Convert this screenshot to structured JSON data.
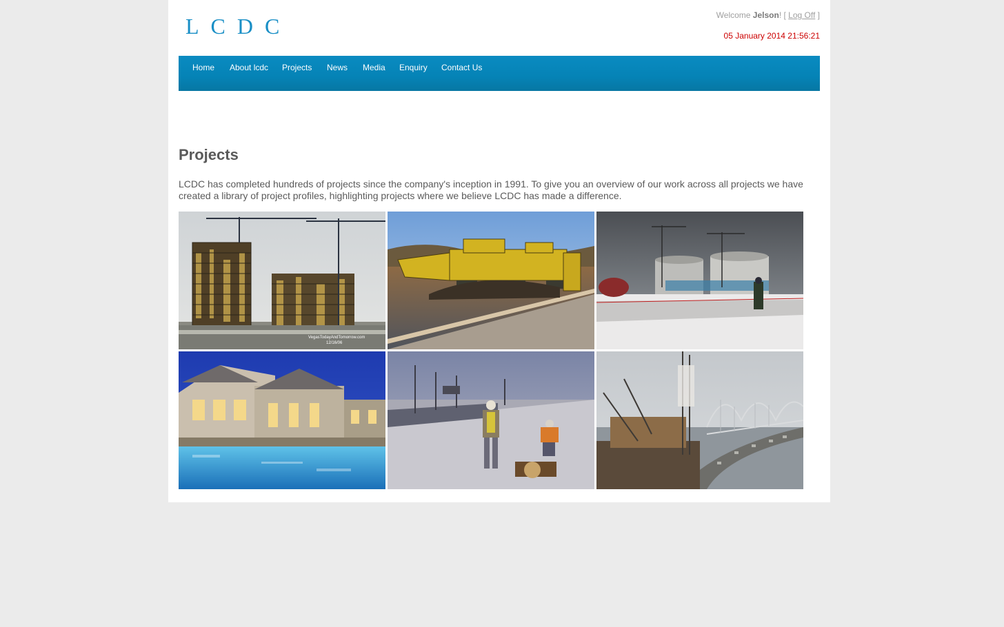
{
  "header": {
    "logo_letters": [
      "L",
      "C",
      "D",
      "C"
    ],
    "welcome_prefix": "Welcome",
    "username": "Jelson",
    "welcome_suffix": "! [",
    "logoff_label": "Log Off",
    "logoff_close": "]",
    "datetime": "05 January 2014 21:56:21"
  },
  "nav": {
    "items": [
      "Home",
      "About lcdc",
      "Projects",
      "News",
      "Media",
      "Enquiry",
      "Contact Us"
    ]
  },
  "main": {
    "title": "Projects",
    "intro": "LCDC has completed hundreds of projects since the company's inception in 1991. To give you an overview of our work across all projects we have created a library of project profiles, highlighting projects where we believe LCDC has made a difference."
  },
  "gallery": {
    "tiles": [
      {
        "icon": "highrise-construction-photo",
        "caption": "VegasTodayAndTomorrow.com 12/16/06"
      },
      {
        "icon": "road-paver-photo"
      },
      {
        "icon": "lng-tank-construction-photo"
      },
      {
        "icon": "pool-clubhouse-photo"
      },
      {
        "icon": "road-workers-photo"
      },
      {
        "icon": "bridge-construction-photo"
      }
    ]
  },
  "colors": {
    "accent": "#0a8bc1",
    "datetime": "#cc0000",
    "text": "#5a5a5a",
    "page_bg": "#ebebeb"
  }
}
